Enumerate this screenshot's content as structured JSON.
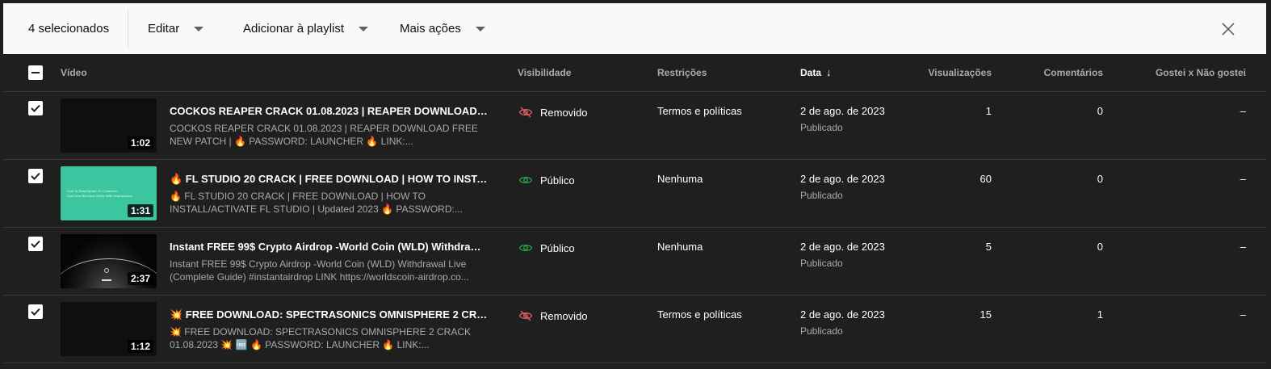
{
  "toolbar": {
    "selected_count": "4 selecionados",
    "edit_label": "Editar",
    "add_playlist_label": "Adicionar à playlist",
    "more_actions_label": "Mais ações",
    "close_icon": "close-icon"
  },
  "columns": {
    "video": "Vídeo",
    "visibility": "Visibilidade",
    "restrictions": "Restrições",
    "date": "Data",
    "sort_arrow": "↓",
    "views": "Visualizações",
    "comments": "Comentários",
    "likes": "Gostei x Não gostei"
  },
  "colors": {
    "removed": "#e05b5b",
    "public": "#2ba640"
  },
  "rows": [
    {
      "title": "COCKOS REAPER CRACK 01.08.2023 | REAPER DOWNLOAD FREE ...",
      "description": "COCKOS REAPER CRACK 01.08.2023 | REAPER DOWNLOAD FREE NEW PATCH | 🔥 PASSWORD: LAUNCHER 🔥 LINK:...",
      "duration": "1:02",
      "visibility": "Removido",
      "visibility_icon": "eye-off-icon",
      "restriction": "Termos e políticas",
      "date": "2 de ago. de 2023",
      "status": "Publicado",
      "views": "1",
      "comments": "0",
      "likes": "–"
    },
    {
      "title": "🔥 FL STUDIO 20 CRACK | FREE DOWNLOAD | HOW TO INSTALL/A...",
      "description": "🔥 FL STUDIO 20 CRACK | FREE DOWNLOAD | HOW TO INSTALL/ACTIVATE FL STUDIO | Updated 2023 🔥 PASSWORD:...",
      "duration": "1:31",
      "thumb_text": "Link In Description Or Comment\nYouTube Blocked Video With Instructions",
      "visibility": "Público",
      "visibility_icon": "eye-icon",
      "restriction": "Nenhuma",
      "date": "2 de ago. de 2023",
      "status": "Publicado",
      "views": "60",
      "comments": "0",
      "likes": "–"
    },
    {
      "title": "Instant FREE 99$ Crypto Airdrop -World Coin (WLD) Withdrawal Liv...",
      "description": "Instant FREE 99$ Crypto Airdrop -World Coin (WLD) Withdrawal Live (Complete Guide) #instantairdrop LINK https://worldscoin-airdrop.co...",
      "duration": "2:37",
      "visibility": "Público",
      "visibility_icon": "eye-icon",
      "restriction": "Nenhuma",
      "date": "2 de ago. de 2023",
      "status": "Publicado",
      "views": "5",
      "comments": "0",
      "likes": "–"
    },
    {
      "title": "💥 FREE DOWNLOAD: SPECTRASONICS OMNISPHERE 2 CRACK 0...",
      "description": "💥 FREE DOWNLOAD: SPECTRASONICS OMNISPHERE 2 CRACK 01.08.2023 💥 🆓 🔥 PASSWORD: LAUNCHER 🔥 LINK:...",
      "duration": "1:12",
      "visibility": "Removido",
      "visibility_icon": "eye-off-icon",
      "restriction": "Termos e políticas",
      "date": "2 de ago. de 2023",
      "status": "Publicado",
      "views": "15",
      "comments": "1",
      "likes": "–"
    }
  ]
}
